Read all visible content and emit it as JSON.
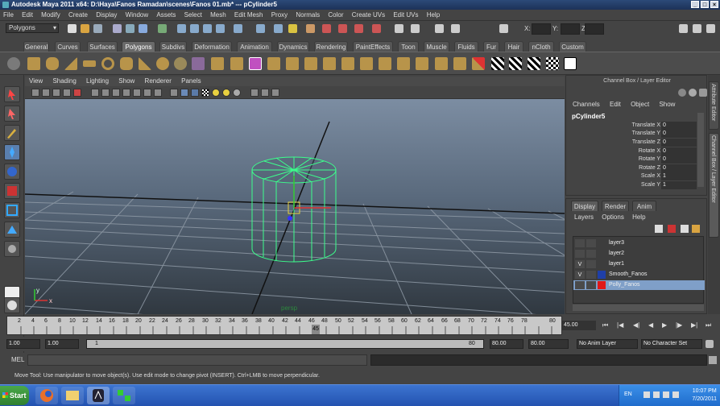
{
  "window": {
    "title": "Autodesk Maya 2011 x64: D:\\Haya\\Fanos Ramadan\\scenes\\Fanos 01.mb*   ---   pCylinder5"
  },
  "menubar": [
    "File",
    "Edit",
    "Modify",
    "Create",
    "Display",
    "Window",
    "Assets",
    "Select",
    "Mesh",
    "Edit Mesh",
    "Proxy",
    "Normals",
    "Color",
    "Create UVs",
    "Edit UVs",
    "Help"
  ],
  "statusline": {
    "mode": "Polygons",
    "x_label": "X:",
    "y_label": "Y:",
    "z_label": "Z:"
  },
  "shelf_tabs": [
    "General",
    "Curves",
    "Surfaces",
    "Polygons",
    "Subdivs",
    "Deformation",
    "Animation",
    "Dynamics",
    "Rendering",
    "PaintEffects",
    "Toon",
    "Muscle",
    "Fluids",
    "Fur",
    "Hair",
    "nCloth",
    "Custom"
  ],
  "shelf_active": "Polygons",
  "viewport_menu": [
    "View",
    "Shading",
    "Lighting",
    "Show",
    "Renderer",
    "Panels"
  ],
  "viewport": {
    "object_label": "persp",
    "axis_x": "x",
    "axis_y": "y"
  },
  "channel_box": {
    "title": "Channel Box / Layer Editor",
    "menu": [
      "Channels",
      "Edit",
      "Object",
      "Show"
    ],
    "object": "pCylinder5",
    "attributes": [
      {
        "name": "Translate X",
        "value": "0"
      },
      {
        "name": "Translate Y",
        "value": "0"
      },
      {
        "name": "Translate Z",
        "value": "0"
      },
      {
        "name": "Rotate X",
        "value": "0"
      },
      {
        "name": "Rotate Y",
        "value": "0"
      },
      {
        "name": "Rotate Z",
        "value": "0"
      },
      {
        "name": "Scale X",
        "value": "1"
      },
      {
        "name": "Scale Y",
        "value": "1"
      }
    ]
  },
  "layer_editor": {
    "tabs": [
      "Display",
      "Render",
      "Anim"
    ],
    "menu": [
      "Layers",
      "Options",
      "Help"
    ],
    "layers": [
      {
        "name": "layer3",
        "visible": "",
        "color": "#3d3d3d"
      },
      {
        "name": "layer2",
        "visible": "",
        "color": "#3d3d3d"
      },
      {
        "name": "layer1",
        "visible": "V",
        "color": "#3d3d3d"
      },
      {
        "name": "Smooth_Fanos",
        "visible": "V",
        "color": "#1f3fa8"
      },
      {
        "name": "Polly_Fanos",
        "visible": "",
        "color": "#e01818"
      }
    ],
    "selected": "Polly_Fanos"
  },
  "side_tabs": [
    "Attribute Editor",
    "Channel Box / Layer Editor"
  ],
  "timeline": {
    "ticks": [
      "2",
      "4",
      "6",
      "8",
      "10",
      "12",
      "14",
      "16",
      "18",
      "20",
      "22",
      "24",
      "26",
      "28",
      "30",
      "32",
      "34",
      "36",
      "38",
      "40",
      "42",
      "44",
      "46",
      "48",
      "50",
      "52",
      "54",
      "56",
      "58",
      "60",
      "62",
      "64",
      "66",
      "68",
      "70",
      "72",
      "74",
      "76",
      "78",
      "80"
    ],
    "current_frame": "45",
    "current_time": "45.00"
  },
  "range": {
    "start": "1.00",
    "start_inner": "1.00",
    "slider_start": "1",
    "slider_end": "80",
    "end_inner": "80.00",
    "end": "80.00",
    "anim_layer": "No Anim Layer",
    "character_set": "No Character Set"
  },
  "mel": {
    "label": "MEL"
  },
  "status_bar": "Move Tool: Use manipulator to move object(s). Use edit mode to change pivot (INSERT).  Ctrl+LMB to move perpendicular.",
  "taskbar": {
    "start": "Start",
    "lang": "EN",
    "time": "10:07 PM",
    "date": "7/20/2011"
  }
}
